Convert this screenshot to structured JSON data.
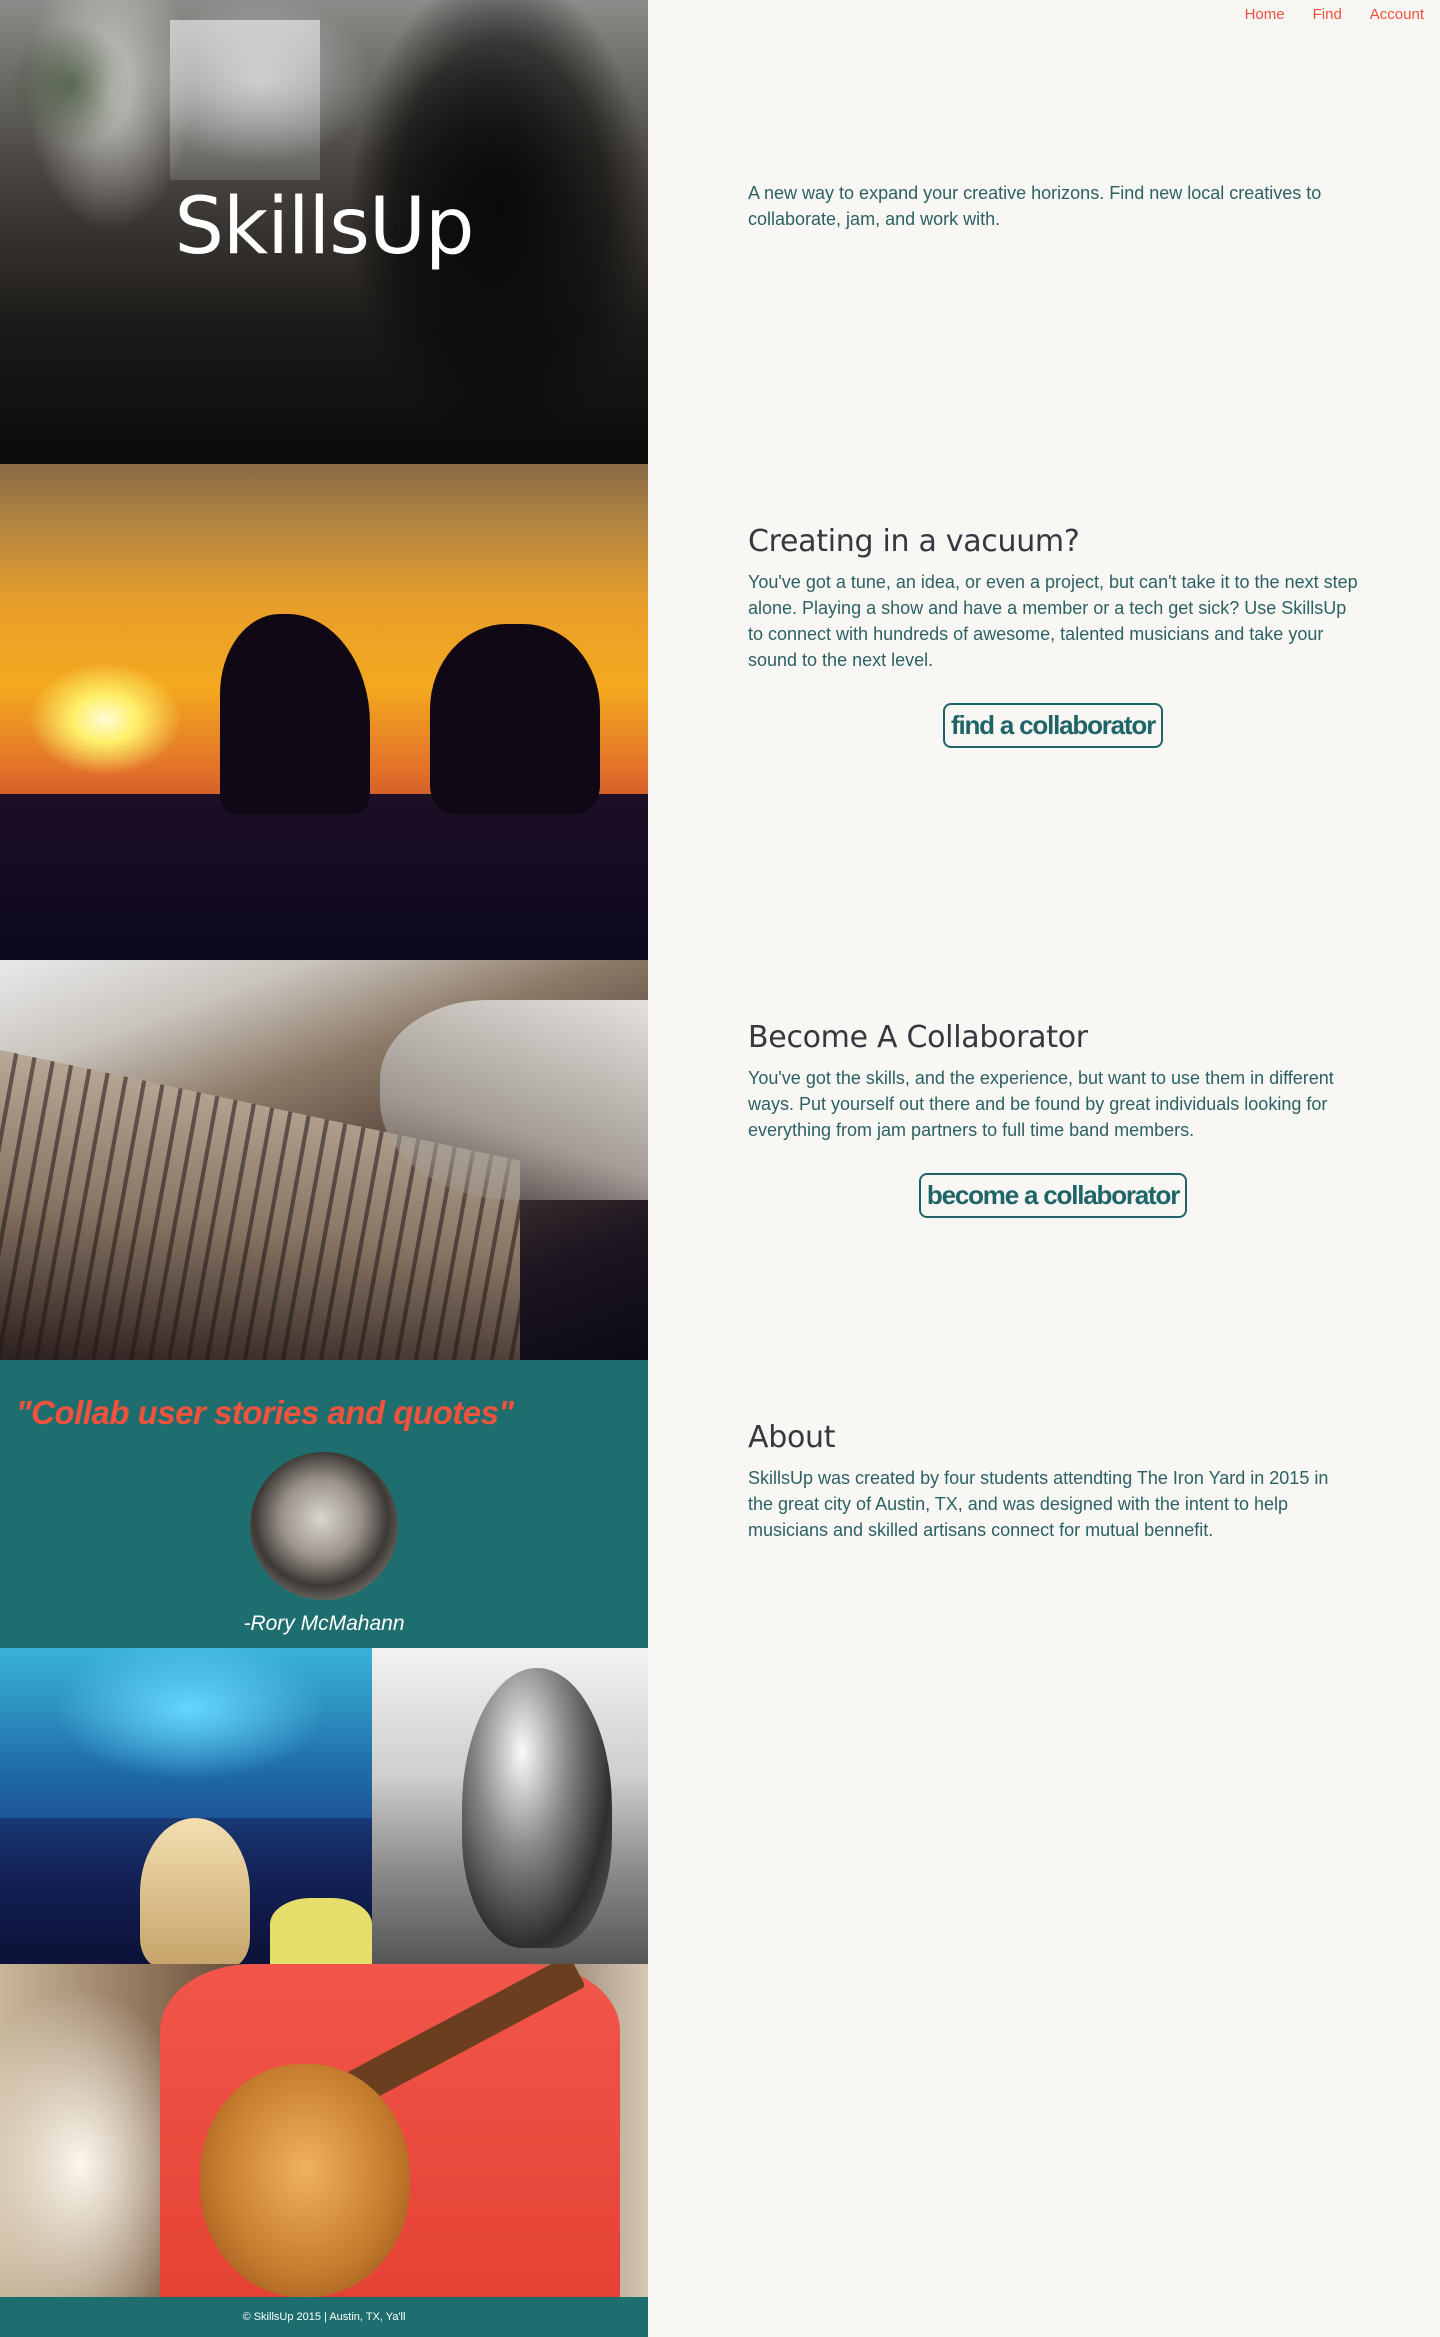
{
  "nav": {
    "home": "Home",
    "find": "Find",
    "account": "Account"
  },
  "hero": {
    "title": "SkillsUp",
    "tagline": "A new way to expand your creative horizons. Find new local creatives to collaborate, jam, and work with."
  },
  "sections": [
    {
      "heading": "Creating in a vacuum?",
      "body": "You've got a tune, an idea, or even a project, but can't take it to the next step alone. Playing a show and have a member or a tech get sick? Use SkillsUp to connect with hundreds of awesome, talented musicians and take your sound to the next level.",
      "button": "find a collaborator"
    },
    {
      "heading": "Become A Collaborator",
      "body": "You've got the skills, and the experience, but want to use them in different ways. Put yourself out there and be found by great individuals looking for everything from jam partners to full time band members.",
      "button": "become a collaborator"
    },
    {
      "heading": "About",
      "body": "SkillsUp was created by four students attendting The Iron Yard in 2015 in the great city of Austin, TX, and was designed with the intent to help musicians and skilled artisans connect for mutual bennefit."
    }
  ],
  "quote": {
    "text": "\"Collab user stories and quotes\"",
    "author": "-Rory McMahann"
  },
  "footer": {
    "text": "© SkillsUp 2015 | Austin, TX, Ya'll"
  },
  "colors": {
    "accent": "#f0523c",
    "teal": "#1f6e6f",
    "background": "#f8f7f4"
  }
}
